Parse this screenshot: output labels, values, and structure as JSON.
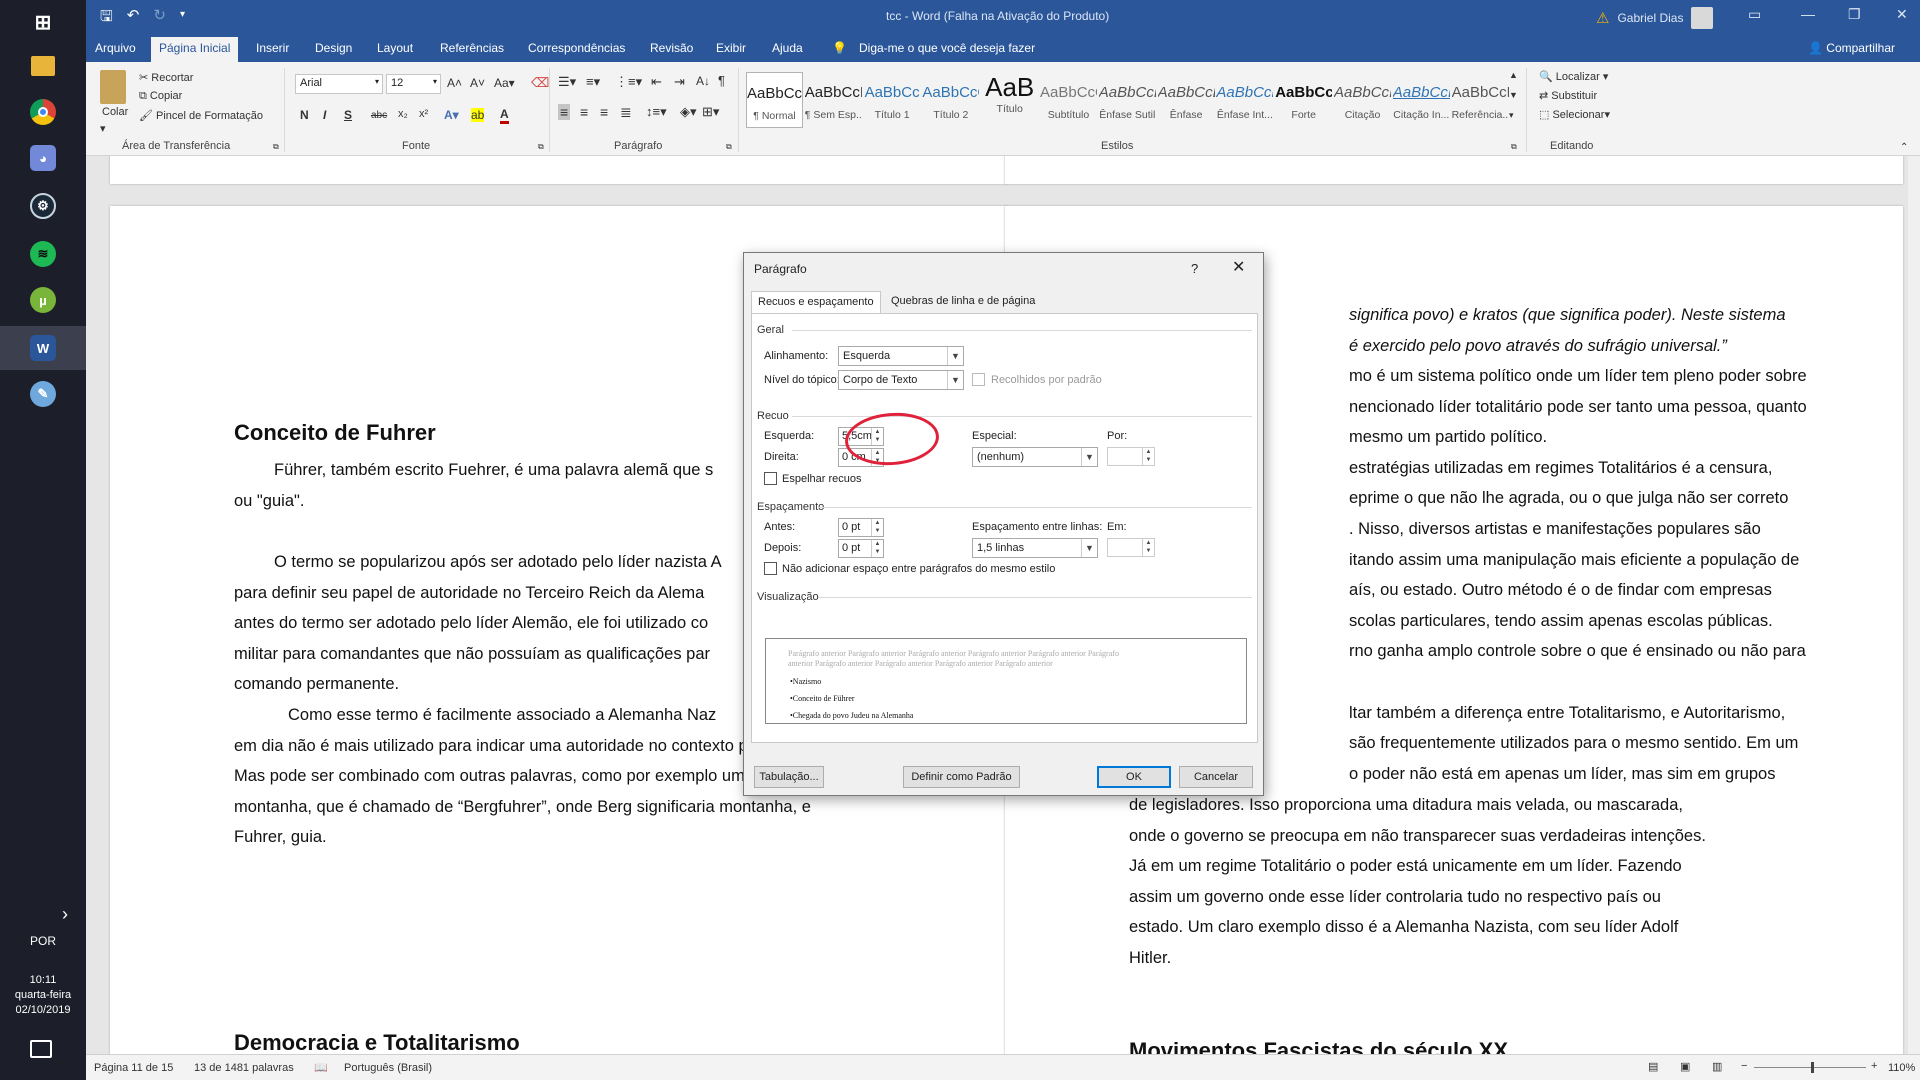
{
  "taskbar": {
    "icons": [
      "windows-start-icon",
      "file-explorer-icon",
      "chrome-icon",
      "discord-icon",
      "steam-icon",
      "spotify-icon",
      "utorrent-icon",
      "word-icon",
      "paint-icon"
    ],
    "language": "POR",
    "time": "10:11",
    "weekday": "quarta-feira",
    "date": "02/10/2019"
  },
  "titlebar": {
    "title": "tcc  -  Word (Falha na Ativação do Produto)",
    "user": "Gabriel Dias"
  },
  "menu": {
    "tabs": [
      "Arquivo",
      "Página Inicial",
      "Inserir",
      "Design",
      "Layout",
      "Referências",
      "Correspondências",
      "Revisão",
      "Exibir",
      "Ajuda"
    ],
    "tell_me": "Diga-me o que você deseja fazer",
    "share": "Compartilhar"
  },
  "ribbon": {
    "clipboard": {
      "paste": "Colar",
      "cut": "Recortar",
      "copy": "Copiar",
      "format_painter": "Pincel de Formatação",
      "label": "Área de Transferência"
    },
    "font": {
      "name": "Arial",
      "size": "12",
      "label": "Fonte"
    },
    "paragraph": {
      "label": "Parágrafo"
    },
    "styles": {
      "label": "Estilos",
      "items": [
        {
          "preview": "AaBbCcI",
          "name": "¶ Normal"
        },
        {
          "preview": "AaBbCcI",
          "name": "¶ Sem Esp..."
        },
        {
          "preview": "AaBbCc",
          "name": "Título 1"
        },
        {
          "preview": "AaBbCcC",
          "name": "Título 2"
        },
        {
          "preview": "AaB",
          "name": "Título"
        },
        {
          "preview": "AaBbCcC",
          "name": "Subtítulo"
        },
        {
          "preview": "AaBbCcD",
          "name": "Ênfase Sutil"
        },
        {
          "preview": "AaBbCcD",
          "name": "Ênfase"
        },
        {
          "preview": "AaBbCcD",
          "name": "Ênfase Int..."
        },
        {
          "preview": "AaBbCcD",
          "name": "Forte"
        },
        {
          "preview": "AaBbCcI",
          "name": "Citação"
        },
        {
          "preview": "AaBbCcI",
          "name": "Citação In..."
        },
        {
          "preview": "AaBbCcD",
          "name": "Referência..."
        }
      ]
    },
    "editing": {
      "find": "Localizar",
      "replace": "Substituir",
      "select": "Selecionar",
      "label": "Editando"
    }
  },
  "left_page": {
    "heading1": "Conceito de Fuhrer",
    "para1": [
      "Führer, também escrito Fuehrer, é uma palavra alemã que s",
      "ou \"guia\"."
    ],
    "para2": [
      "O termo se popularizou após ser adotado pelo líder nazista A",
      "para definir seu papel de autoridade no Terceiro Reich da Alema",
      "antes do termo ser adotado pelo líder Alemão, ele foi utilizado co",
      "militar para comandantes que não possuíam as qualificações par",
      "comando permanente."
    ],
    "para3": [
      "Como esse termo é facilmente associado a Alemanha Naz",
      "em dia não é mais utilizado para indicar uma autoridade no contexto político.",
      "Mas pode ser combinado com outras palavras, como por exemplo um guia de",
      "montanha, que é chamado de “Bergfuhrer”, onde Berg significaria montanha, e",
      "Fuhrer, guia."
    ],
    "heading2": "Democracia e Totalitarismo"
  },
  "right_page": {
    "lines": [
      "significa povo) e kratos (que significa poder). Neste sistema",
      "é exercido pelo povo através do sufrágio universal.”",
      "mo é um sistema político onde um líder tem pleno poder sobre",
      "nencionado líder totalitário pode ser tanto uma pessoa, quanto",
      "mesmo um partido político.",
      "estratégias utilizadas em regimes Totalitários é a censura,",
      "eprime o que não lhe agrada, ou o que julga não ser correto",
      ".  Nisso, diversos artistas e manifestações populares são",
      "itando assim uma manipulação mais eficiente a população de",
      "aís, ou estado. Outro método é o de findar com empresas",
      "scolas particulares, tendo assim apenas escolas públicas.",
      "rno ganha amplo controle sobre o que é ensinado ou não para",
      "",
      "ltar também a diferença entre Totalitarismo, e Autoritarismo,",
      "são frequentemente utilizados para o mesmo sentido. Em um",
      "o poder não está em apenas um líder, mas sim em grupos"
    ],
    "lines_full": [
      "de legisladores. Isso proporciona uma ditadura mais velada, ou mascarada,",
      "onde o governo se preocupa em não transparecer suas verdadeiras intenções.",
      "Já em um regime Totalitário o poder está unicamente em um líder. Fazendo",
      "assim um governo onde esse líder controlaria tudo no respectivo país ou",
      "estado. Um claro exemplo disso é a Alemanha Nazista, com seu líder Adolf",
      "Hitler."
    ],
    "heading": "Movimentos Fascistas do século XX"
  },
  "dialog": {
    "title": "Parágrafo",
    "help": "?",
    "tab_indent": "Recuos e espaçamento",
    "tab_breaks": "Quebras de linha e de página",
    "general": "Geral",
    "alignment_label": "Alinhamento:",
    "alignment": "Esquerda",
    "outline_label": "Nível do tópico:",
    "outline": "Corpo de Texto",
    "collapsed": "Recolhidos por padrão",
    "indent": "Recuo",
    "left_label": "Esquerda:",
    "left_value": "5,5cm",
    "right_label": "Direita:",
    "right_value": "0 cm",
    "special_label": "Especial:",
    "special": "(nenhum)",
    "by_label": "Por:",
    "mirror": "Espelhar recuos",
    "spacing": "Espaçamento",
    "before_label": "Antes:",
    "before": "0 pt",
    "after_label": "Depois:",
    "after": "0 pt",
    "line_spacing_label": "Espaçamento entre linhas:",
    "line_spacing": "1,5 linhas",
    "at_label": "Em:",
    "no_space": "Não adicionar espaço entre parágrafos do mesmo estilo",
    "preview_label": "Visualização",
    "preview_prev": [
      "Parágrafo anterior Parágrafo anterior Parágrafo anterior Parágrafo anterior Parágrafo anterior Parágrafo",
      "anterior Parágrafo anterior Parágrafo anterior Parágrafo anterior Parágrafo anterior"
    ],
    "preview_items": [
      "•Nazismo",
      "•Conceito de Führer",
      "•Chegada do povo Judeu na Alemanha"
    ],
    "tabs_btn": "Tabulação...",
    "default_btn": "Definir como Padrão",
    "ok": "OK",
    "cancel": "Cancelar"
  },
  "status": {
    "page": "Página 11 de 15",
    "words": "13 de 1481 palavras",
    "language": "Português (Brasil)",
    "zoom": "110%"
  }
}
